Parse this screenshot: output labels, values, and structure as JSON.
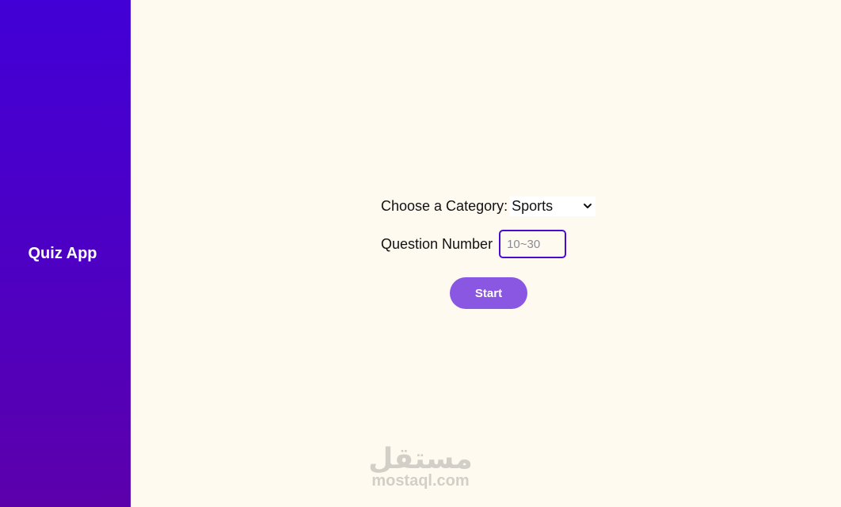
{
  "sidebar": {
    "title": "Quiz App"
  },
  "form": {
    "category_label": "Choose a Category:",
    "category_selected": "Sports",
    "question_number_label": "Question Number",
    "question_number_placeholder": "10~30",
    "question_number_value": "",
    "start_label": "Start"
  },
  "watermark": {
    "arabic": "مستقل",
    "latin": "mostaql.com"
  },
  "colors": {
    "sidebar_gradient_top": "#4200d6",
    "sidebar_gradient_bottom": "#5c00ab",
    "background": "#fffaf0",
    "accent_button": "#8a57e2",
    "input_border": "#4a0ad0"
  },
  "icons": {
    "select_arrow": "chevron-down-icon"
  }
}
